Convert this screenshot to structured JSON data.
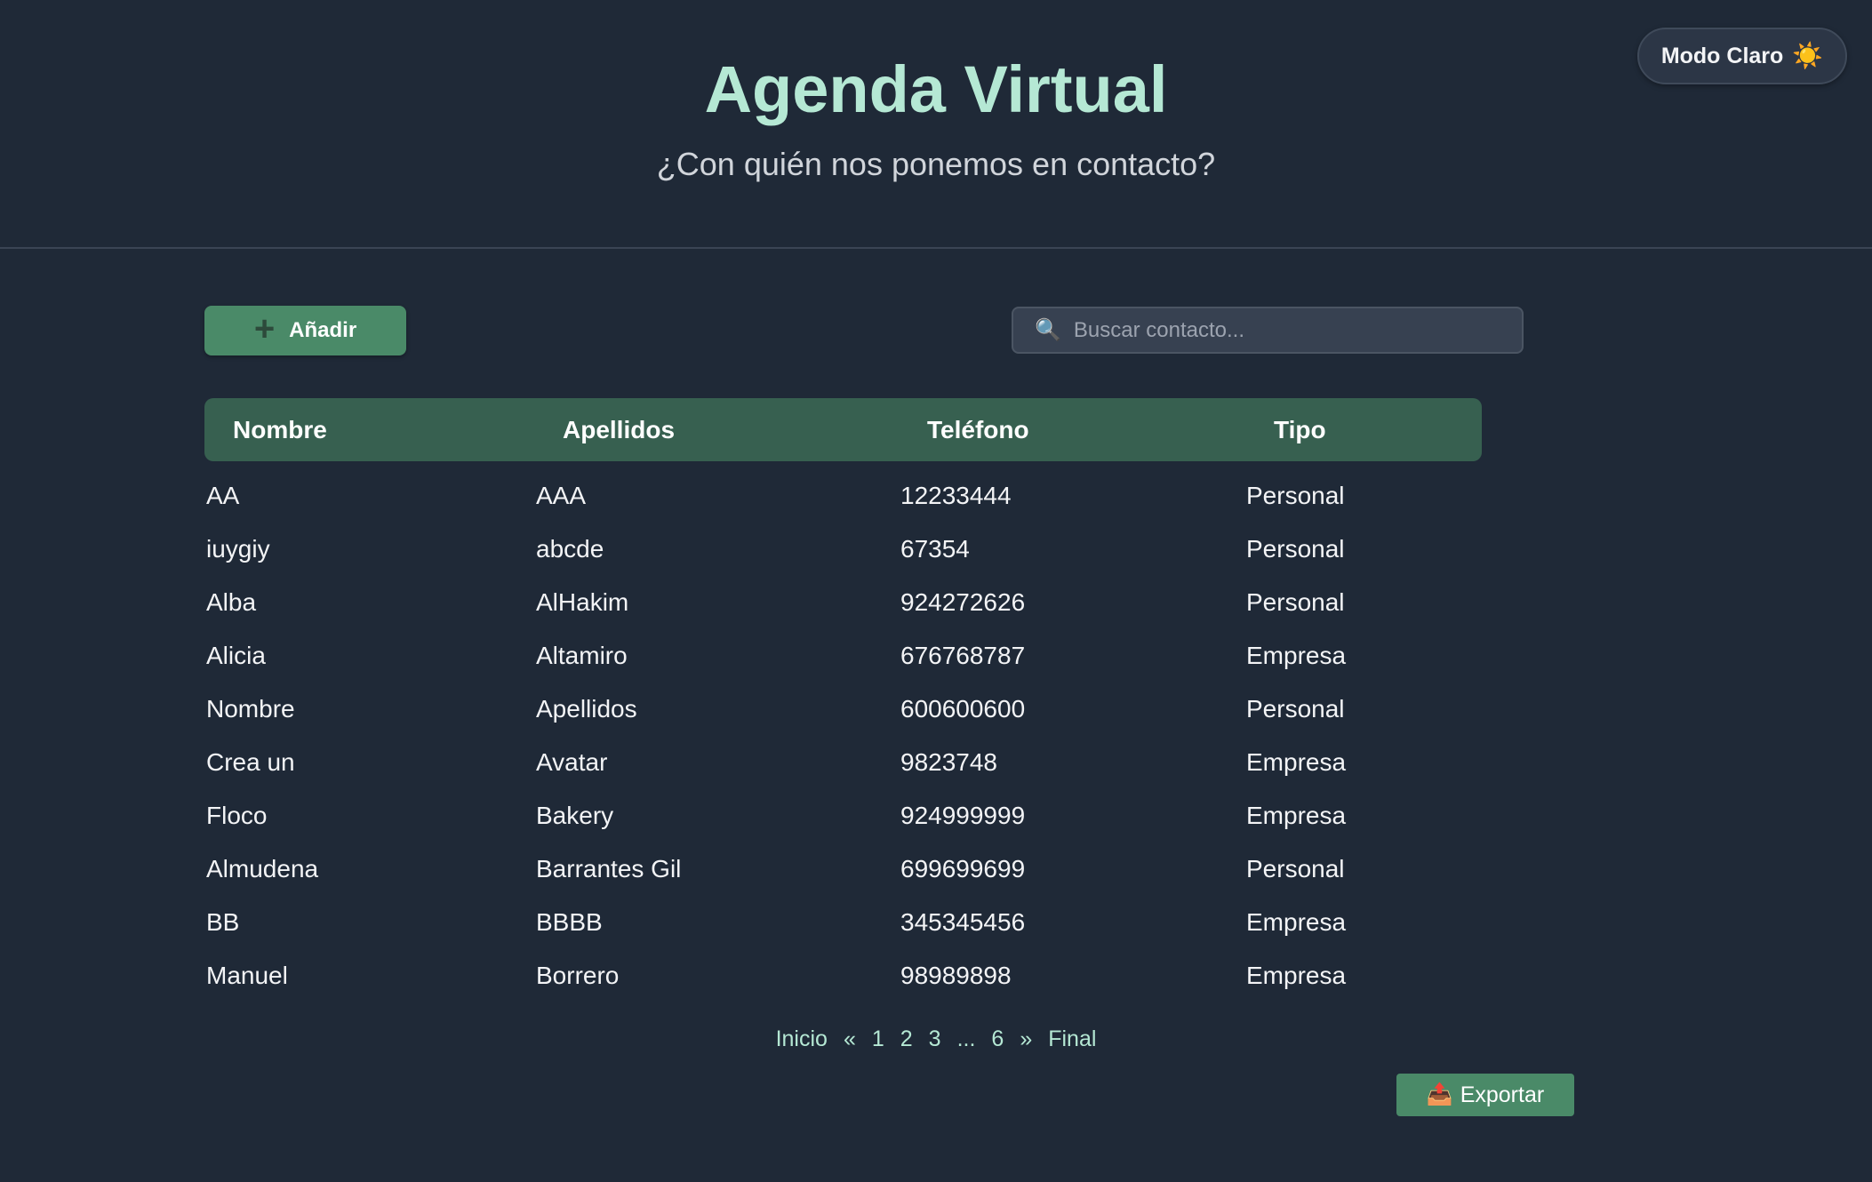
{
  "header": {
    "title": "Agenda Virtual",
    "subtitle": "¿Con quién nos ponemos en contacto?",
    "theme_toggle": {
      "label": "Modo Claro",
      "icon": "sun-icon",
      "icon_glyph": "☀️"
    }
  },
  "toolbar": {
    "add_button": {
      "label": "Añadir",
      "icon": "plus-icon",
      "icon_glyph": "+"
    },
    "search": {
      "placeholder": "Buscar contacto...",
      "value": "",
      "icon": "search-icon",
      "icon_glyph": "🔍"
    }
  },
  "table": {
    "columns": [
      "Nombre",
      "Apellidos",
      "Teléfono",
      "Tipo"
    ],
    "rows": [
      [
        "AA",
        "AAA",
        "12233444",
        "Personal"
      ],
      [
        "iuygiy",
        "abcde",
        "67354",
        "Personal"
      ],
      [
        "Alba",
        "AlHakim",
        "924272626",
        "Personal"
      ],
      [
        "Alicia",
        "Altamiro",
        "676768787",
        "Empresa"
      ],
      [
        "Nombre",
        "Apellidos",
        "600600600",
        "Personal"
      ],
      [
        "Crea un",
        "Avatar",
        "9823748",
        "Empresa"
      ],
      [
        "Floco",
        "Bakery",
        "924999999",
        "Empresa"
      ],
      [
        "Almudena",
        "Barrantes Gil",
        "699699699",
        "Personal"
      ],
      [
        "BB",
        "BBBB",
        "345345456",
        "Empresa"
      ],
      [
        "Manuel",
        "Borrero",
        "98989898",
        "Empresa"
      ]
    ]
  },
  "pagination": {
    "items": [
      "Inicio",
      "«",
      "1",
      "2",
      "3",
      "...",
      "6",
      "»",
      "Final"
    ]
  },
  "export": {
    "label": "Exportar",
    "icon": "export-icon",
    "icon_glyph": "📤"
  },
  "colors": {
    "background": "#1f2937",
    "title": "#b5e8d4",
    "accent_green": "#4a8a68",
    "table_header": "#376050"
  }
}
